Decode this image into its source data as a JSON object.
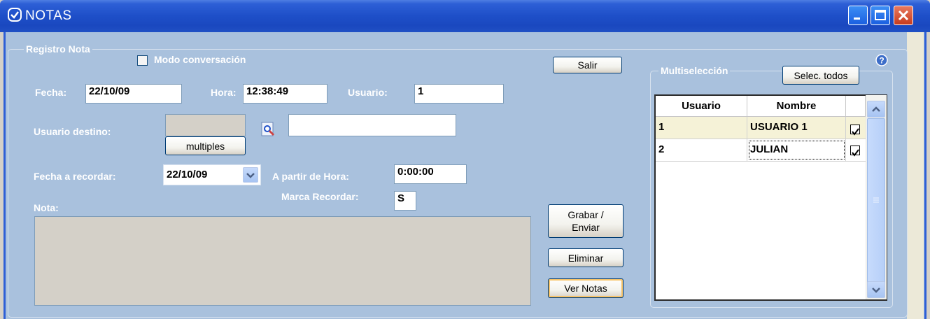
{
  "window": {
    "title": "NOTAS"
  },
  "form": {
    "group_label": "Registro Nota",
    "modo_conversacion": "Modo conversación",
    "fecha_label": "Fecha:",
    "fecha_value": "22/10/09",
    "hora_label": "Hora:",
    "hora_value": "12:38:49",
    "usuario_label": "Usuario:",
    "usuario_value": "1",
    "usuario_destino_label": "Usuario destino:",
    "usuario_destino_value": "",
    "usuario_destino_name": "",
    "multiples_label": "multiples",
    "fecha_recordar_label": "Fecha a recordar:",
    "fecha_recordar_value": "22/10/09",
    "a_partir_label": "A partir de Hora:",
    "a_partir_value": "0:00:00",
    "marca_label": "Marca Recordar:",
    "marca_value": "S",
    "nota_label": "Nota:",
    "nota_value": ""
  },
  "buttons": {
    "salir": "Salir",
    "grabar_line1": "Grabar /",
    "grabar_line2": "Enviar",
    "eliminar": "Eliminar",
    "ver_notas": "Ver Notas"
  },
  "multi": {
    "group_label": "Multiselección",
    "select_all": "Selec. todos",
    "headers": [
      "Usuario",
      "Nombre"
    ],
    "rows": [
      {
        "usuario": "1",
        "nombre": "USUARIO 1",
        "checked": true
      },
      {
        "usuario": "2",
        "nombre": "JULIAN",
        "checked": true
      }
    ]
  },
  "colors": {
    "title_bar": "#1e4fc8",
    "client_bg": "#a9c1dd",
    "label_text": "#ffffff"
  }
}
